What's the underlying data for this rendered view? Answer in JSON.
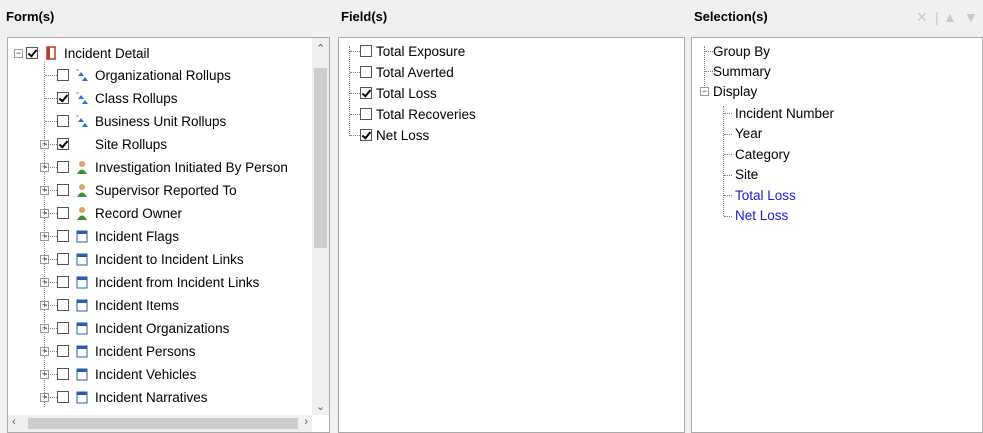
{
  "forms": {
    "header": "Form(s)",
    "root": {
      "label": "Incident Detail",
      "checked": true
    },
    "items": [
      {
        "label": "Organizational Rollups",
        "checked": false,
        "icon": "rollup-icon",
        "expand": false
      },
      {
        "label": "Class Rollups",
        "checked": true,
        "icon": "rollup-icon",
        "expand": false
      },
      {
        "label": "Business Unit Rollups",
        "checked": false,
        "icon": "rollup-icon",
        "expand": false
      },
      {
        "label": "Site Rollups",
        "checked": true,
        "icon": "none",
        "expand": true
      },
      {
        "label": "Investigation Initiated By Person",
        "checked": false,
        "icon": "person-icon",
        "expand": true
      },
      {
        "label": "Supervisor Reported To",
        "checked": false,
        "icon": "person-icon",
        "expand": true
      },
      {
        "label": "Record Owner",
        "checked": false,
        "icon": "person-icon",
        "expand": true
      },
      {
        "label": "Incident Flags",
        "checked": false,
        "icon": "table-icon",
        "expand": true
      },
      {
        "label": "Incident to Incident Links",
        "checked": false,
        "icon": "table-icon",
        "expand": true
      },
      {
        "label": "Incident from Incident Links",
        "checked": false,
        "icon": "table-icon",
        "expand": true
      },
      {
        "label": "Incident Items",
        "checked": false,
        "icon": "table-icon",
        "expand": true
      },
      {
        "label": "Incident Organizations",
        "checked": false,
        "icon": "table-icon",
        "expand": true
      },
      {
        "label": "Incident Persons",
        "checked": false,
        "icon": "table-icon",
        "expand": true
      },
      {
        "label": "Incident Vehicles",
        "checked": false,
        "icon": "table-icon",
        "expand": true
      },
      {
        "label": "Incident Narratives",
        "checked": false,
        "icon": "table-icon",
        "expand": true
      }
    ]
  },
  "fields": {
    "header": "Field(s)",
    "items": [
      {
        "label": "Total Exposure",
        "checked": false
      },
      {
        "label": "Total Averted",
        "checked": false
      },
      {
        "label": "Total Loss",
        "checked": true
      },
      {
        "label": "Total Recoveries",
        "checked": false
      },
      {
        "label": "Net Loss",
        "checked": true
      }
    ]
  },
  "selections": {
    "header": "Selection(s)",
    "top": [
      "Group By",
      "Summary",
      "Display"
    ],
    "display_items": [
      {
        "label": "Incident Number",
        "highlight": false
      },
      {
        "label": "Year",
        "highlight": false
      },
      {
        "label": "Category",
        "highlight": false
      },
      {
        "label": "Site",
        "highlight": false
      },
      {
        "label": "Total Loss",
        "highlight": true
      },
      {
        "label": "Net Loss",
        "highlight": true
      }
    ]
  },
  "colors": {
    "highlight": "#1a1adb",
    "rollup": "#2a6fd8",
    "person": "#3a8f3a",
    "table": "#2b5aa8"
  }
}
